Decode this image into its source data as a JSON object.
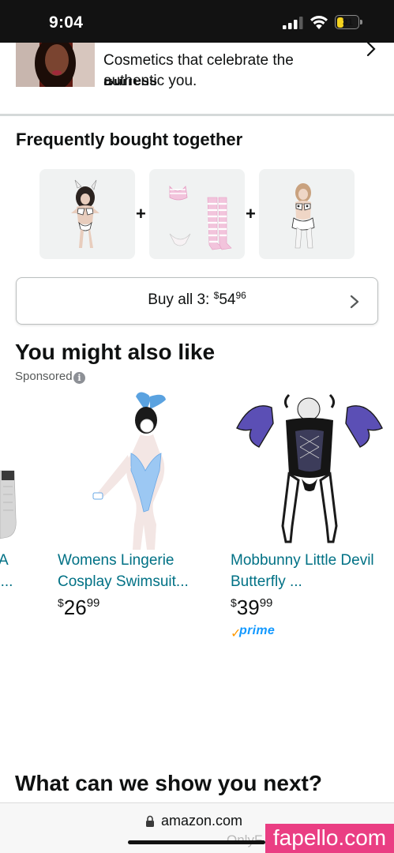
{
  "status_bar": {
    "time": "9:04",
    "battery_level": "31",
    "icons": [
      "cellular-signal-icon",
      "wifi-icon",
      "battery-icon"
    ]
  },
  "brand_promo": {
    "brand_name": "Burress",
    "description": "Cosmetics that celebrate the authentic you.",
    "chevron_icon": "chevron-right-icon"
  },
  "frequently_bought": {
    "title": "Frequently bought together",
    "plus_sign": "+",
    "items": [
      {
        "image": "costume-outfit-1"
      },
      {
        "image": "striped-bikini-with-stockings"
      },
      {
        "image": "costume-outfit-3"
      }
    ],
    "buy_all_label": "Buy all 3: ",
    "buy_all_currency": "$",
    "buy_all_whole": "54",
    "buy_all_cents": "96"
  },
  "you_might_also_like": {
    "title": "You might also like",
    "sponsored_label": "Sponsored",
    "info_icon_glyph": "i",
    "products": [
      {
        "title_fragment_1": "A",
        "title_fragment_2": "n...",
        "image": "stocking-product"
      },
      {
        "title": "Womens Lingerie Cosplay Swimsuit...",
        "currency": "$",
        "whole": "26",
        "cents": "99",
        "image": "blue-bunny-cosplay-swimsuit"
      },
      {
        "title": "Mobbunny Little Devil Butterfly ...",
        "currency": "$",
        "whole": "39",
        "cents": "99",
        "image": "devil-butterfly-wings-outfit",
        "prime_check": "✓",
        "prime_label": "prime"
      }
    ]
  },
  "next_section": {
    "title": "What can we show you next?"
  },
  "bottom_bar": {
    "url": "amazon.com",
    "lock_icon": "lock-icon"
  },
  "watermark": {
    "faint_text": "OnlyF",
    "site": "fapello.com"
  },
  "colors": {
    "link": "#007185",
    "prime_blue": "#1399ff",
    "prime_check": "#ff9900",
    "watermark_pink": "#ea3e83",
    "battery_yellow": "#f4d21f",
    "status_bar": "#121212"
  }
}
